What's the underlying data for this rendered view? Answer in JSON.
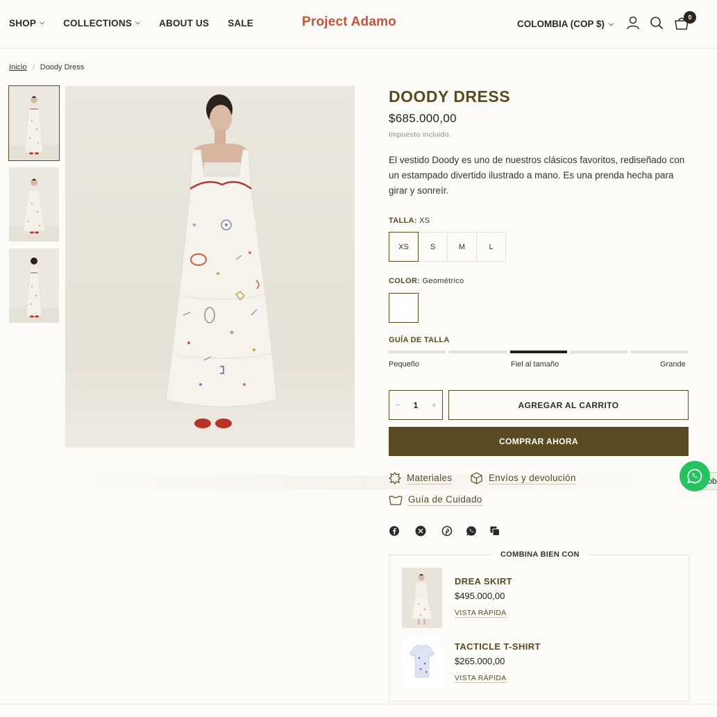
{
  "header": {
    "nav": [
      {
        "label": "SHOP",
        "dropdown": true
      },
      {
        "label": "COLLECTIONS",
        "dropdown": true
      },
      {
        "label": "ABOUT US",
        "dropdown": false
      },
      {
        "label": "SALE",
        "dropdown": false
      }
    ],
    "logo": "Project Adamo",
    "currency": "COLOMBIA (COP $)",
    "cart_count": "0",
    "icons": [
      "user-icon",
      "search-icon",
      "cart-icon"
    ]
  },
  "breadcrumb": {
    "home": "Inicio",
    "current": "Doody Dress"
  },
  "gallery": {
    "thumbnails": 3,
    "active_index": 0
  },
  "product": {
    "title": "DOODY DRESS",
    "price": "$685.000,00",
    "tax_note": "Impuesto incluido.",
    "description": "El vestido Doody es uno de nuestros clásicos favoritos, rediseñado con un estampado divertido ilustrado a mano. Es una prenda hecha para girar y sonreír.",
    "size_label": "TALLA:",
    "size_selected": "XS",
    "sizes": [
      "XS",
      "S",
      "M",
      "L"
    ],
    "color_label": "COLOR:",
    "color_selected": "Geométrico",
    "size_guide_label": "GUÍA DE TALLA",
    "fit": {
      "left": "Pequeño",
      "center": "Fiel al tamaño",
      "right": "Grande",
      "active_segment": 3,
      "segments": 5
    },
    "quantity": "1",
    "add_to_cart": "AGREGAR AL CARRITO",
    "buy_now": "COMPRAR AHORA",
    "links": [
      "Materiales",
      "Envíos y devolución",
      "Guía de Cuidado"
    ],
    "share_icons": [
      "facebook-icon",
      "x-icon",
      "pinterest-icon",
      "whatsapp-icon",
      "copy-link-icon"
    ]
  },
  "combo": {
    "title": "COMBINA BIEN CON",
    "items": [
      {
        "name": "DREA SKIRT",
        "price": "$495.000,00",
        "quick_view": "VISTA RÁPIDA"
      },
      {
        "name": "TACTICLE T-SHIRT",
        "price": "$265.000,00",
        "quick_view": "VISTA RÁPIDA"
      }
    ]
  },
  "whatsapp": {
    "tag": "Qob"
  },
  "colors": {
    "brand": "#5a4a22",
    "logo": "#c2553c",
    "background": "#fdfbf7",
    "whatsapp": "#25c25f"
  }
}
